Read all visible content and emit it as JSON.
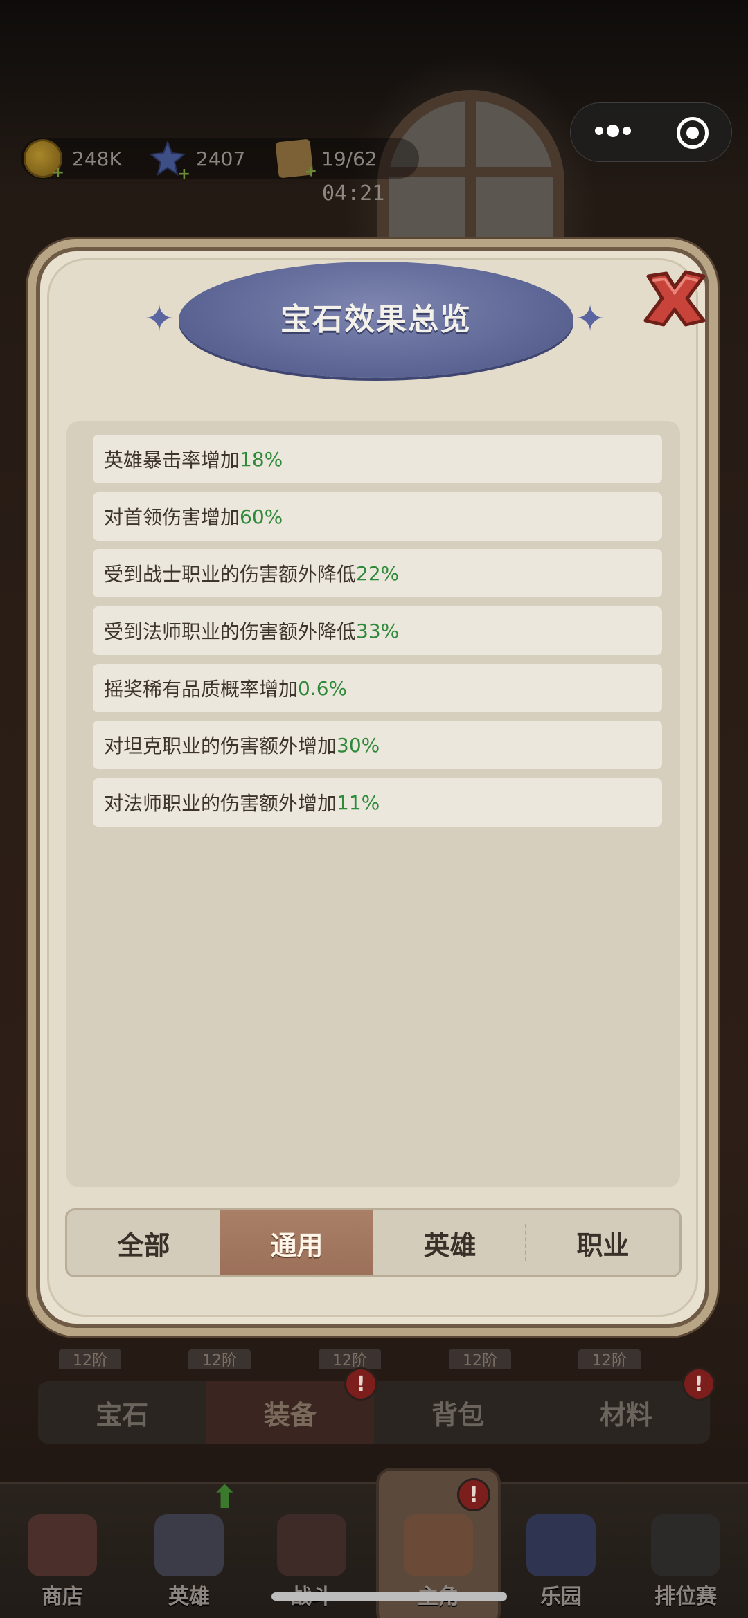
{
  "resources": {
    "coins": "248K",
    "gems": "2407",
    "cookies": "19/62",
    "timer": "04:21"
  },
  "dialog": {
    "title": "宝石效果总览",
    "effects": [
      {
        "text": "英雄暴击率增加",
        "value": "18%"
      },
      {
        "text": "对首领伤害增加",
        "value": "60%"
      },
      {
        "text": "受到战士职业的伤害额外降低",
        "value": "22%"
      },
      {
        "text": "受到法师职业的伤害额外降低",
        "value": "33%"
      },
      {
        "text": "摇奖稀有品质概率增加",
        "value": "0.6%"
      },
      {
        "text": "对坦克职业的伤害额外增加",
        "value": "30%"
      },
      {
        "text": "对法师职业的伤害额外增加",
        "value": "11%"
      }
    ],
    "tabs": [
      "全部",
      "通用",
      "英雄",
      "职业"
    ],
    "active_tab": "通用"
  },
  "background_panel": {
    "tier_chip": "12阶",
    "tabs": [
      "宝石",
      "装备",
      "背包",
      "材料"
    ],
    "active_tab": "装备",
    "badge": "!"
  },
  "bottom_nav": {
    "items": [
      "商店",
      "英雄",
      "战斗",
      "主角",
      "乐园",
      "排位赛"
    ],
    "active": "主角"
  },
  "colors": {
    "value_green": "#2e8a3a",
    "tab_active": "#a97f66",
    "banner_blue": "#5e6796"
  }
}
